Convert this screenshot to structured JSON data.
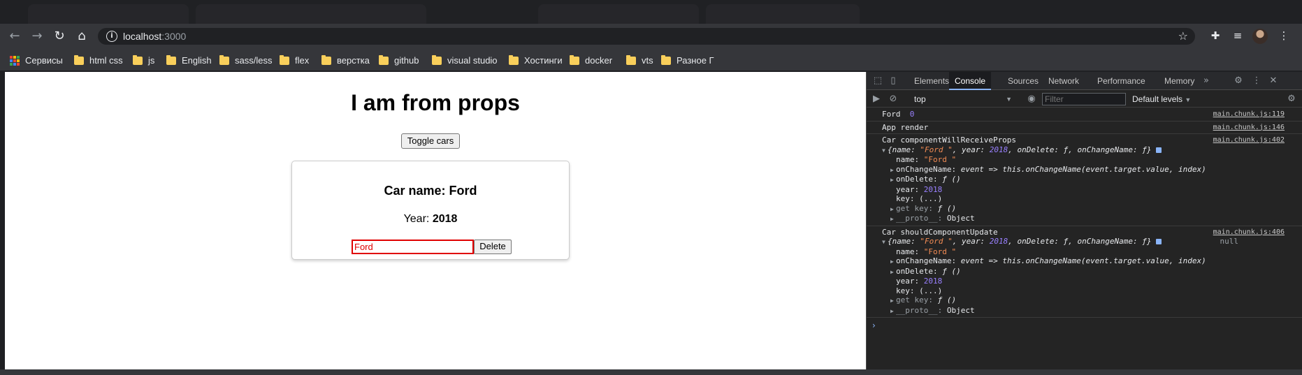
{
  "browser": {
    "url_host": "localhost",
    "url_port": ":3000",
    "bookmarks": [
      {
        "label": "Сервисы",
        "icon": "apps-icon"
      },
      {
        "label": "html css",
        "icon": "folder-icon"
      },
      {
        "label": "js",
        "icon": "folder-icon"
      },
      {
        "label": "English",
        "icon": "folder-icon"
      },
      {
        "label": "sass/less",
        "icon": "folder-icon"
      },
      {
        "label": "flex",
        "icon": "folder-icon"
      },
      {
        "label": "верстка",
        "icon": "folder-icon"
      },
      {
        "label": "github",
        "icon": "folder-icon"
      },
      {
        "label": "visual studio",
        "icon": "folder-icon"
      },
      {
        "label": "Хостинги",
        "icon": "folder-icon"
      },
      {
        "label": "docker",
        "icon": "folder-icon"
      },
      {
        "label": "vts",
        "icon": "folder-icon"
      },
      {
        "label": "Разное Г",
        "icon": "folder-icon"
      }
    ]
  },
  "page": {
    "title": "I am from props",
    "toggle_label": "Toggle cars",
    "car": {
      "name_label": "Car name: Ford",
      "year_label": "Year:",
      "year_value": "2018",
      "input_value": "Ford",
      "delete_label": "Delete"
    }
  },
  "devtools": {
    "tabs": [
      "Elements",
      "Console",
      "Sources",
      "Network",
      "Performance",
      "Memory"
    ],
    "active_tab": "Console",
    "context": "top",
    "filter_placeholder": "Filter",
    "levels": "Default levels",
    "logs": {
      "l1": {
        "text": "Ford",
        "num": "0",
        "src": "main.chunk.js:119"
      },
      "l2": {
        "text": "App render",
        "src": "main.chunk.js:146"
      },
      "l3": {
        "title": "Car componentWillReceiveProps",
        "src": "main.chunk.js:402",
        "summary_open": "{name: ",
        "summary_name": "\"Ford \"",
        "summary_year_k": ", year: ",
        "summary_year": "2018",
        "summary_rest": ", onDelete: ƒ, onChangeName: ƒ}",
        "name_k": "name: ",
        "name_v": "\"Ford \"",
        "onchange_k": "onChangeName: ",
        "onchange_v": "event => this.onChangeName(event.target.value, index)",
        "ondelete_k": "onDelete: ",
        "ondelete_v": "ƒ ()",
        "year_k": "year: ",
        "year_v": "2018",
        "key_k": "key: ",
        "key_v": "(...)",
        "getkey_k": "get key: ",
        "getkey_v": "ƒ ()",
        "proto_k": "__proto__: ",
        "proto_v": "Object"
      },
      "l4": {
        "title": "Car  shouldComponentUpdate",
        "src": "main.chunk.js:406",
        "null_v": "null",
        "summary_open": "{name: ",
        "summary_name": "\"Ford \"",
        "summary_year_k": ", year: ",
        "summary_year": "2018",
        "summary_rest": ", onDelete: ƒ, onChangeName: ƒ}",
        "name_k": "name: ",
        "name_v": "\"Ford \"",
        "onchange_k": "onChangeName: ",
        "onchange_v": "event => this.onChangeName(event.target.value, index)",
        "ondelete_k": "onDelete: ",
        "ondelete_v": "ƒ ()",
        "year_k": "year: ",
        "year_v": "2018",
        "key_k": "key: ",
        "key_v": "(...)",
        "getkey_k": "get key: ",
        "getkey_v": "ƒ ()",
        "proto_k": "__proto__: ",
        "proto_v": "Object"
      }
    }
  }
}
